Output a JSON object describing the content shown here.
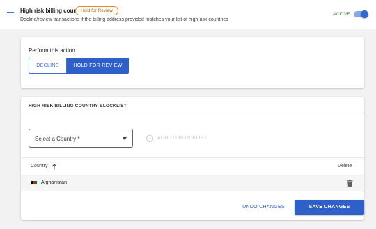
{
  "rule": {
    "title": "High risk billing country",
    "status_chip": "Hold for Review",
    "description": "Decline/review transactions if the billing address provided matches your list of high-risk countries",
    "active_label": "ACTIVE",
    "active": true
  },
  "action": {
    "label": "Perform this action",
    "options": [
      "DECLINE",
      "HOLD FOR REVIEW"
    ],
    "selected": "HOLD FOR REVIEW"
  },
  "blocklist": {
    "title": "HIGH RISK BILLING COUNTRY BLOCKLIST",
    "select_placeholder": "Select a Country *",
    "add_button": "ADD TO BLOCKLIST",
    "columns": {
      "country": "Country",
      "delete": "Delete"
    },
    "sort_icon": "arrow-up-icon",
    "rows": [
      {
        "country": "Afghanistan",
        "flag_colors": [
          "#000000",
          "#d32011",
          "#007a36"
        ]
      }
    ]
  },
  "footer": {
    "undo": "UNDO CHANGES",
    "save": "SAVE CHANGES"
  },
  "colors": {
    "accent": "#2f5fc8",
    "chip_border": "#e08a2a",
    "active_green": "#2e7d32"
  }
}
